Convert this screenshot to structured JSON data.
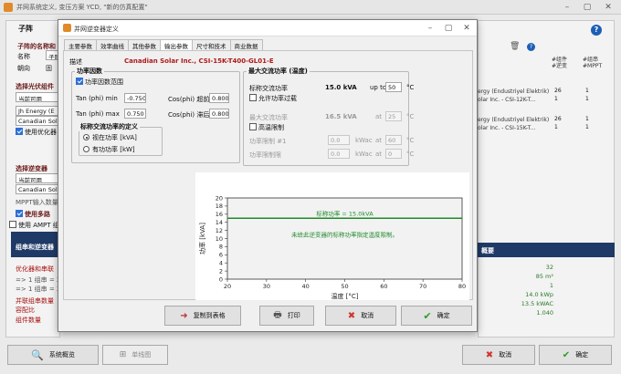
{
  "back_window": {
    "title": "并网系统定义, 变压方案 YCD, \"新的仿真配置\"",
    "panel_title": "子阵",
    "left": {
      "name_label": "子阵的名称和",
      "name_field": "名称",
      "name_value": "子阵",
      "orient_label": "朝向",
      "orient_value": "固",
      "module_section": "选择光伏组件",
      "avail_label": "当前可用",
      "module_mfr": "Jh Energy (E",
      "module_model": "Canadian Sola",
      "use_opt_label": "使用优化器",
      "inverter_section": "选择逆变器",
      "inv_avail": "当前可用",
      "inv_model": "Canadian Solar",
      "mppt_label": "MPPT输入数量",
      "use_multi_label": "使用多路",
      "ampt_label": "使用 AMPT 组",
      "design_label": "组串和逆变器",
      "optimizer_label": "优化器和串联",
      "opt_line1": "=> 1 组串 = 26",
      "opt_line2": "=> 1 组串 = 20",
      "parallel_label": "并联组串数量",
      "capacity_label": "容配比",
      "strings_label": "组件数量"
    },
    "right": {
      "col1": "#组件",
      "col1b": "#逆变",
      "col2": "#组串",
      "col2b": "#MPPT",
      "rows": [
        {
          "name": "ergy (Endustriyel Elektrik)",
          "model": "olar Inc. - CSI-12K-T...",
          "a": "26",
          "b": "1"
        },
        {
          "name": "ergy (Endustriyel Elektrik)",
          "model": "olar Inc. - CSI-15K-T...",
          "a": "26",
          "b": "1"
        }
      ],
      "summary_title": "概要",
      "summary_values": [
        "32",
        "85 m²",
        "1",
        "14.0 kWp",
        "13.5 kWAC",
        "1.040"
      ]
    },
    "footer": {
      "overview_btn": "系统概览",
      "single_line_btn": "单线图",
      "cancel_btn": "取消",
      "ok_btn": "确定"
    }
  },
  "dialog": {
    "title": "并网逆变器定义",
    "tabs": [
      "主要参数",
      "效率曲线",
      "其他参数",
      "输出参数",
      "尺寸和技术",
      "商业数据"
    ],
    "active_tab": "输出参数",
    "desc_label": "描述",
    "desc_value": "Canadian Solar Inc., CSI-15K-T400-GL01-E",
    "power_factor": {
      "title": "功率因数",
      "checkbox_label": "功率因数范围",
      "tan_min_label": "Tan (phi) min",
      "tan_min_value": "-0.750",
      "tan_max_label": "Tan (phi) max",
      "tan_max_value": "0.750",
      "cos_lead_label": "Cos(phi) 超前",
      "cos_lead_value": "0.800",
      "cos_lag_label": "Cos(phi) 滞后",
      "cos_lag_value": "0.800",
      "nominal_def_title": "标称交流功率的定义",
      "radio_apparent": "视在功率 [kVA]",
      "radio_active": "有功功率 [kW]"
    },
    "max_ac": {
      "title": "最大交流功率 (温度)",
      "nominal_label": "标称交流功率",
      "nominal_value": "15.0 kVA",
      "upto_label": "up to",
      "upto_value": "50",
      "upto_unit": "°C",
      "allow_overload": "允许功率过载",
      "max_label": "最大交流功率",
      "max_value": "16.5 kVA",
      "at_label": "at",
      "max_temp": "25",
      "temp_unit": "°C",
      "derate_label": "高温限制",
      "limit1_label": "功率限制 #1",
      "limit1_value": "0.0",
      "limit1_unit": "kWac",
      "limit1_temp": "60",
      "limit2_label": "功率限制限",
      "limit2_value": "0.0",
      "limit2_unit": "kWac",
      "limit2_temp": "0"
    },
    "chart_data": {
      "type": "line",
      "xlabel": "温度 [°C]",
      "ylabel": "功率 [kVA]",
      "xlim": [
        20,
        80
      ],
      "ylim": [
        0,
        20
      ],
      "xticks": [
        20,
        30,
        40,
        50,
        60,
        70,
        80
      ],
      "yticks": [
        0,
        2,
        4,
        6,
        8,
        10,
        12,
        14,
        16,
        18,
        20
      ],
      "series": [
        {
          "name": "标称功率 = 15.0kVA",
          "x": [
            20,
            80
          ],
          "y": [
            15,
            15
          ],
          "color": "#1f8a2a"
        }
      ],
      "annotation": "未给此逆变器的标称功率指定温度限制。",
      "grid": false,
      "background": "#f2f2f2"
    },
    "buttons": {
      "copy": "复制到表格",
      "print": "打印",
      "cancel": "取消",
      "ok": "确定"
    }
  },
  "colors": {
    "accent": "#2e6fd8",
    "ok_green": "#2a9d2a",
    "cancel_red": "#d0342c",
    "help_blue": "#1c5fb5",
    "chart_green": "#1f8a2a",
    "brand_red": "#b01818"
  }
}
